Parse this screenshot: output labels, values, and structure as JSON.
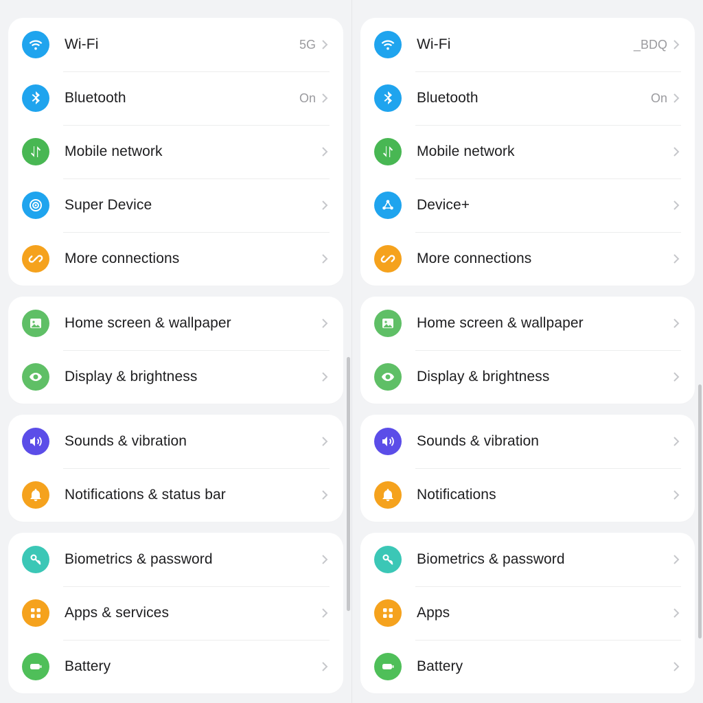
{
  "left": {
    "groups": [
      {
        "items": [
          {
            "id": "wifi",
            "icon": "wifi-icon",
            "color": "bg-blue",
            "label": "Wi-Fi",
            "value": "5G"
          },
          {
            "id": "bt",
            "icon": "bluetooth-icon",
            "color": "bg-blue",
            "label": "Bluetooth",
            "value": "On"
          },
          {
            "id": "mob",
            "icon": "arrows-icon",
            "color": "bg-green",
            "label": "Mobile network",
            "value": ""
          },
          {
            "id": "super",
            "icon": "target-icon",
            "color": "bg-blue",
            "label": "Super Device",
            "value": ""
          },
          {
            "id": "more",
            "icon": "link-icon",
            "color": "bg-orange",
            "label": "More connections",
            "value": ""
          }
        ]
      },
      {
        "items": [
          {
            "id": "home",
            "icon": "image-icon",
            "color": "bg-green2",
            "label": "Home screen & wallpaper",
            "value": ""
          },
          {
            "id": "disp",
            "icon": "eye-icon",
            "color": "bg-green3",
            "label": "Display & brightness",
            "value": ""
          }
        ]
      },
      {
        "items": [
          {
            "id": "snd",
            "icon": "sound-icon",
            "color": "bg-purple",
            "label": "Sounds & vibration",
            "value": ""
          },
          {
            "id": "notif",
            "icon": "bell-icon",
            "color": "bg-orange2",
            "label": "Notifications & status bar",
            "value": ""
          }
        ]
      },
      {
        "items": [
          {
            "id": "bio",
            "icon": "key-icon",
            "color": "bg-teal",
            "label": "Biometrics & password",
            "value": ""
          },
          {
            "id": "apps",
            "icon": "grid-icon",
            "color": "bg-orange3",
            "label": "Apps & services",
            "value": ""
          },
          {
            "id": "bat",
            "icon": "battery-icon",
            "color": "bg-green4",
            "label": "Battery",
            "value": ""
          }
        ]
      }
    ]
  },
  "right": {
    "groups": [
      {
        "items": [
          {
            "id": "wifi",
            "icon": "wifi-icon",
            "color": "bg-blue",
            "label": "Wi-Fi",
            "value": "_BDQ"
          },
          {
            "id": "bt",
            "icon": "bluetooth-icon",
            "color": "bg-blue",
            "label": "Bluetooth",
            "value": "On"
          },
          {
            "id": "mob",
            "icon": "arrows-icon",
            "color": "bg-green",
            "label": "Mobile network",
            "value": ""
          },
          {
            "id": "devp",
            "icon": "share-icon",
            "color": "bg-blue",
            "label": "Device+",
            "value": ""
          },
          {
            "id": "more",
            "icon": "link-icon",
            "color": "bg-orange",
            "label": "More connections",
            "value": ""
          }
        ]
      },
      {
        "items": [
          {
            "id": "home",
            "icon": "image-icon",
            "color": "bg-green2",
            "label": "Home screen & wallpaper",
            "value": ""
          },
          {
            "id": "disp",
            "icon": "eye-icon",
            "color": "bg-green3",
            "label": "Display & brightness",
            "value": ""
          }
        ]
      },
      {
        "items": [
          {
            "id": "snd",
            "icon": "sound-icon",
            "color": "bg-purple",
            "label": "Sounds & vibration",
            "value": ""
          },
          {
            "id": "notif",
            "icon": "bell-icon",
            "color": "bg-orange2",
            "label": "Notifications",
            "value": ""
          }
        ]
      },
      {
        "items": [
          {
            "id": "bio",
            "icon": "key-icon",
            "color": "bg-teal",
            "label": "Biometrics & password",
            "value": ""
          },
          {
            "id": "apps",
            "icon": "grid-icon",
            "color": "bg-orange3",
            "label": "Apps",
            "value": ""
          },
          {
            "id": "bat",
            "icon": "battery-icon",
            "color": "bg-green4",
            "label": "Battery",
            "value": ""
          }
        ]
      }
    ]
  }
}
